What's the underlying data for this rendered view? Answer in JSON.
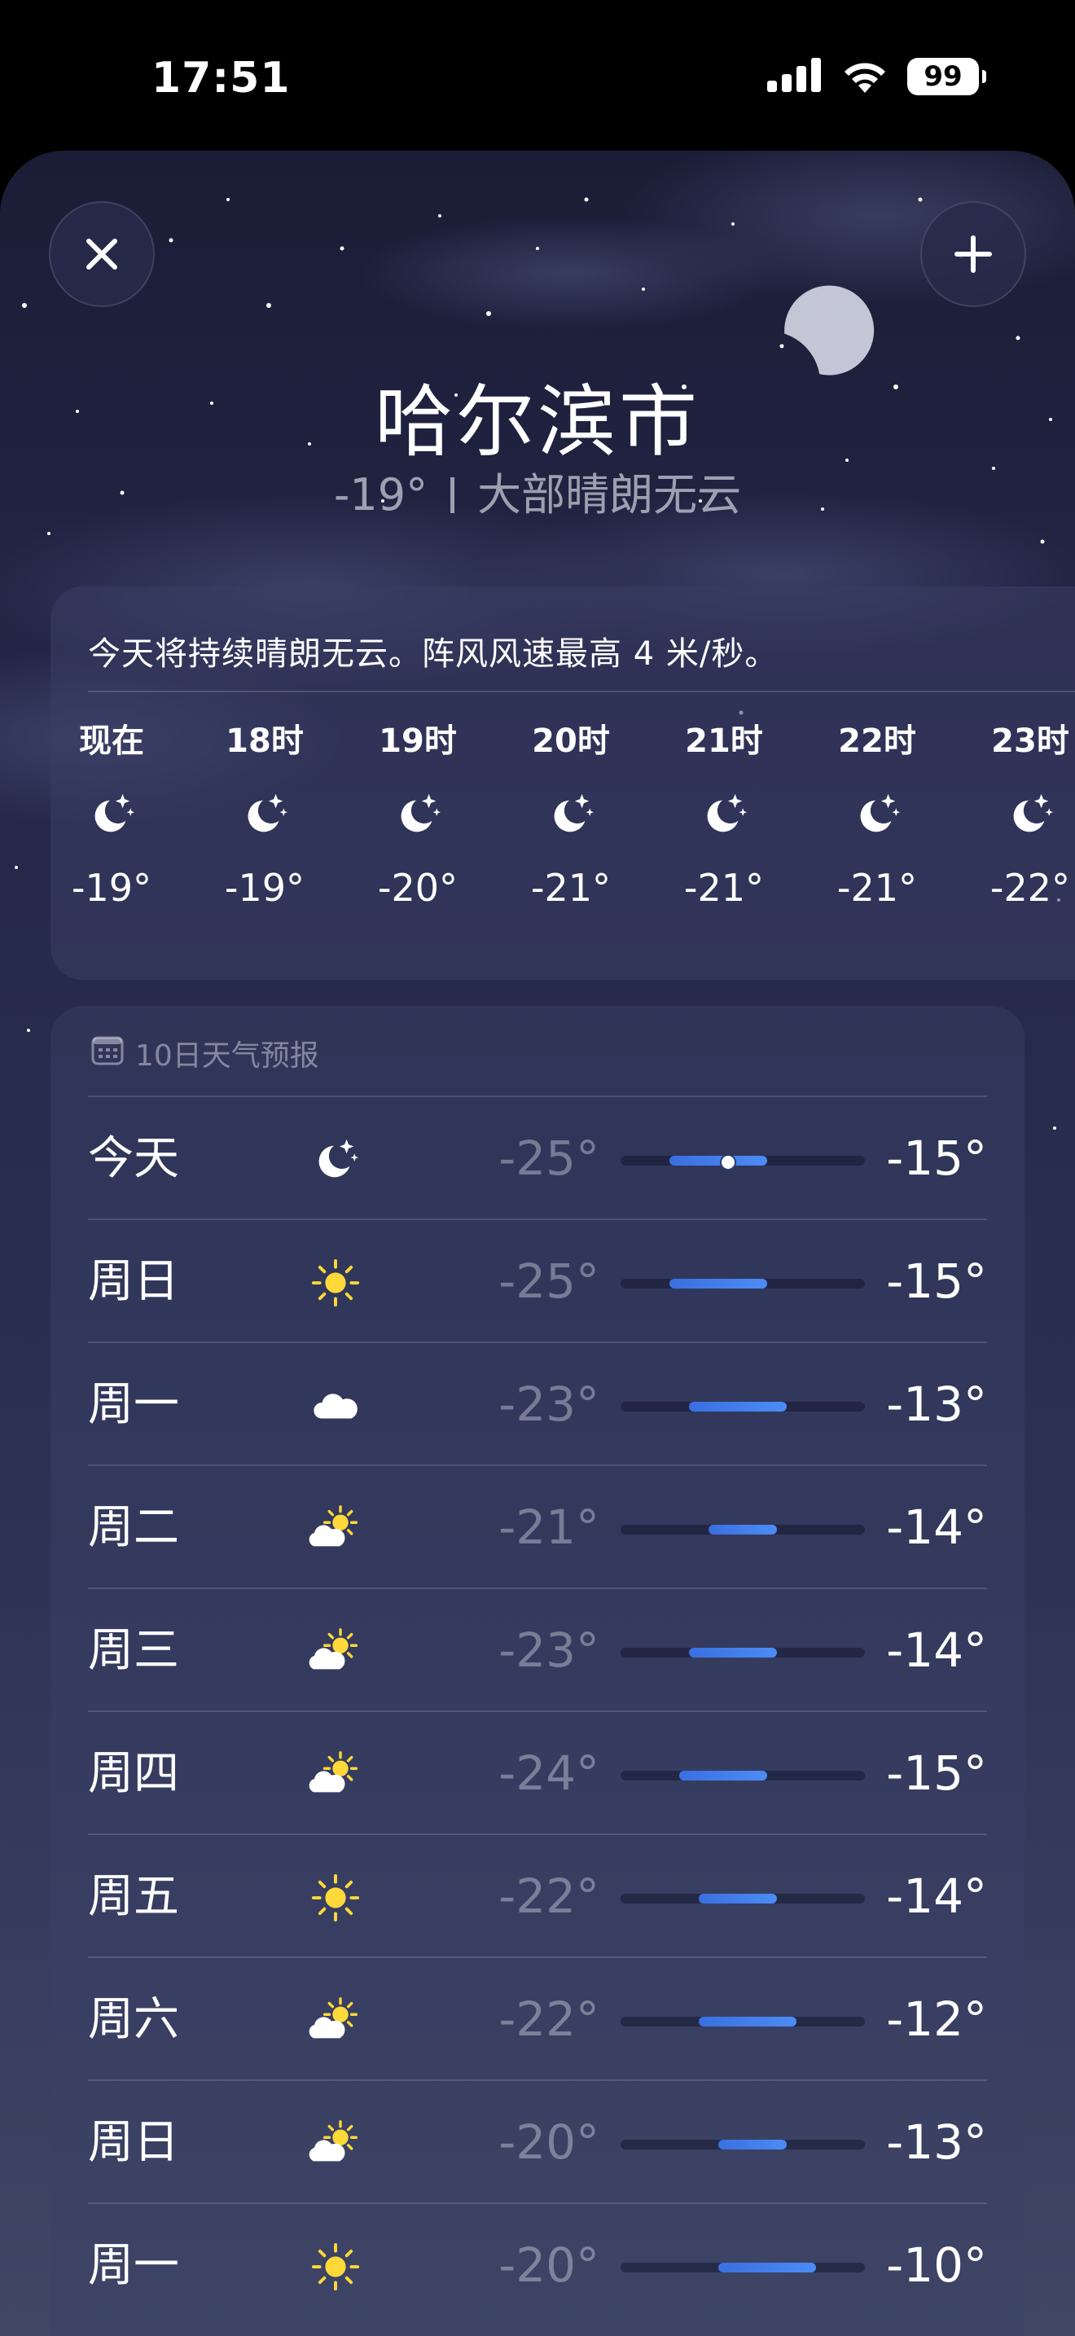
{
  "status_bar": {
    "time": "17:51",
    "battery": "99"
  },
  "header": {
    "city": "哈尔滨市",
    "current_temp": "-19°",
    "condition": "大部晴朗无云"
  },
  "hourly": {
    "summary": "今天将持续晴朗无云。阵风风速最高 4 米/秒。",
    "hours": [
      {
        "label": "现在",
        "icon": "moon-stars-icon",
        "temp": "-19°"
      },
      {
        "label": "18时",
        "icon": "moon-stars-icon",
        "temp": "-19°"
      },
      {
        "label": "19时",
        "icon": "moon-stars-icon",
        "temp": "-20°"
      },
      {
        "label": "20时",
        "icon": "moon-stars-icon",
        "temp": "-21°"
      },
      {
        "label": "21时",
        "icon": "moon-stars-icon",
        "temp": "-21°"
      },
      {
        "label": "22时",
        "icon": "moon-stars-icon",
        "temp": "-21°"
      },
      {
        "label": "23时",
        "icon": "moon-stars-icon",
        "temp": "-22°"
      }
    ]
  },
  "daily": {
    "title": "10日天气预报",
    "range": {
      "min": -30,
      "max": -5
    },
    "current_temp_value": -19,
    "days": [
      {
        "day": "今天",
        "icon": "moon-stars-icon",
        "low": "-25°",
        "high": "-15°",
        "low_v": -25,
        "high_v": -15,
        "show_current": true
      },
      {
        "day": "周日",
        "icon": "sun-icon",
        "low": "-25°",
        "high": "-15°",
        "low_v": -25,
        "high_v": -15
      },
      {
        "day": "周一",
        "icon": "cloud-icon",
        "low": "-23°",
        "high": "-13°",
        "low_v": -23,
        "high_v": -13
      },
      {
        "day": "周二",
        "icon": "partly-sunny-icon",
        "low": "-21°",
        "high": "-14°",
        "low_v": -21,
        "high_v": -14
      },
      {
        "day": "周三",
        "icon": "partly-sunny-icon",
        "low": "-23°",
        "high": "-14°",
        "low_v": -23,
        "high_v": -14
      },
      {
        "day": "周四",
        "icon": "partly-sunny-icon",
        "low": "-24°",
        "high": "-15°",
        "low_v": -24,
        "high_v": -15
      },
      {
        "day": "周五",
        "icon": "sun-icon",
        "low": "-22°",
        "high": "-14°",
        "low_v": -22,
        "high_v": -14
      },
      {
        "day": "周六",
        "icon": "partly-sunny-icon",
        "low": "-22°",
        "high": "-12°",
        "low_v": -22,
        "high_v": -12
      },
      {
        "day": "周日",
        "icon": "partly-sunny-icon",
        "low": "-20°",
        "high": "-13°",
        "low_v": -20,
        "high_v": -13
      },
      {
        "day": "周一",
        "icon": "sun-icon",
        "low": "-20°",
        "high": "-10°",
        "low_v": -20,
        "high_v": -10
      }
    ]
  },
  "colors": {
    "bar_fill": "#4c8cf5",
    "sun": "#ffd83a",
    "background_top": "#1b1d36"
  }
}
